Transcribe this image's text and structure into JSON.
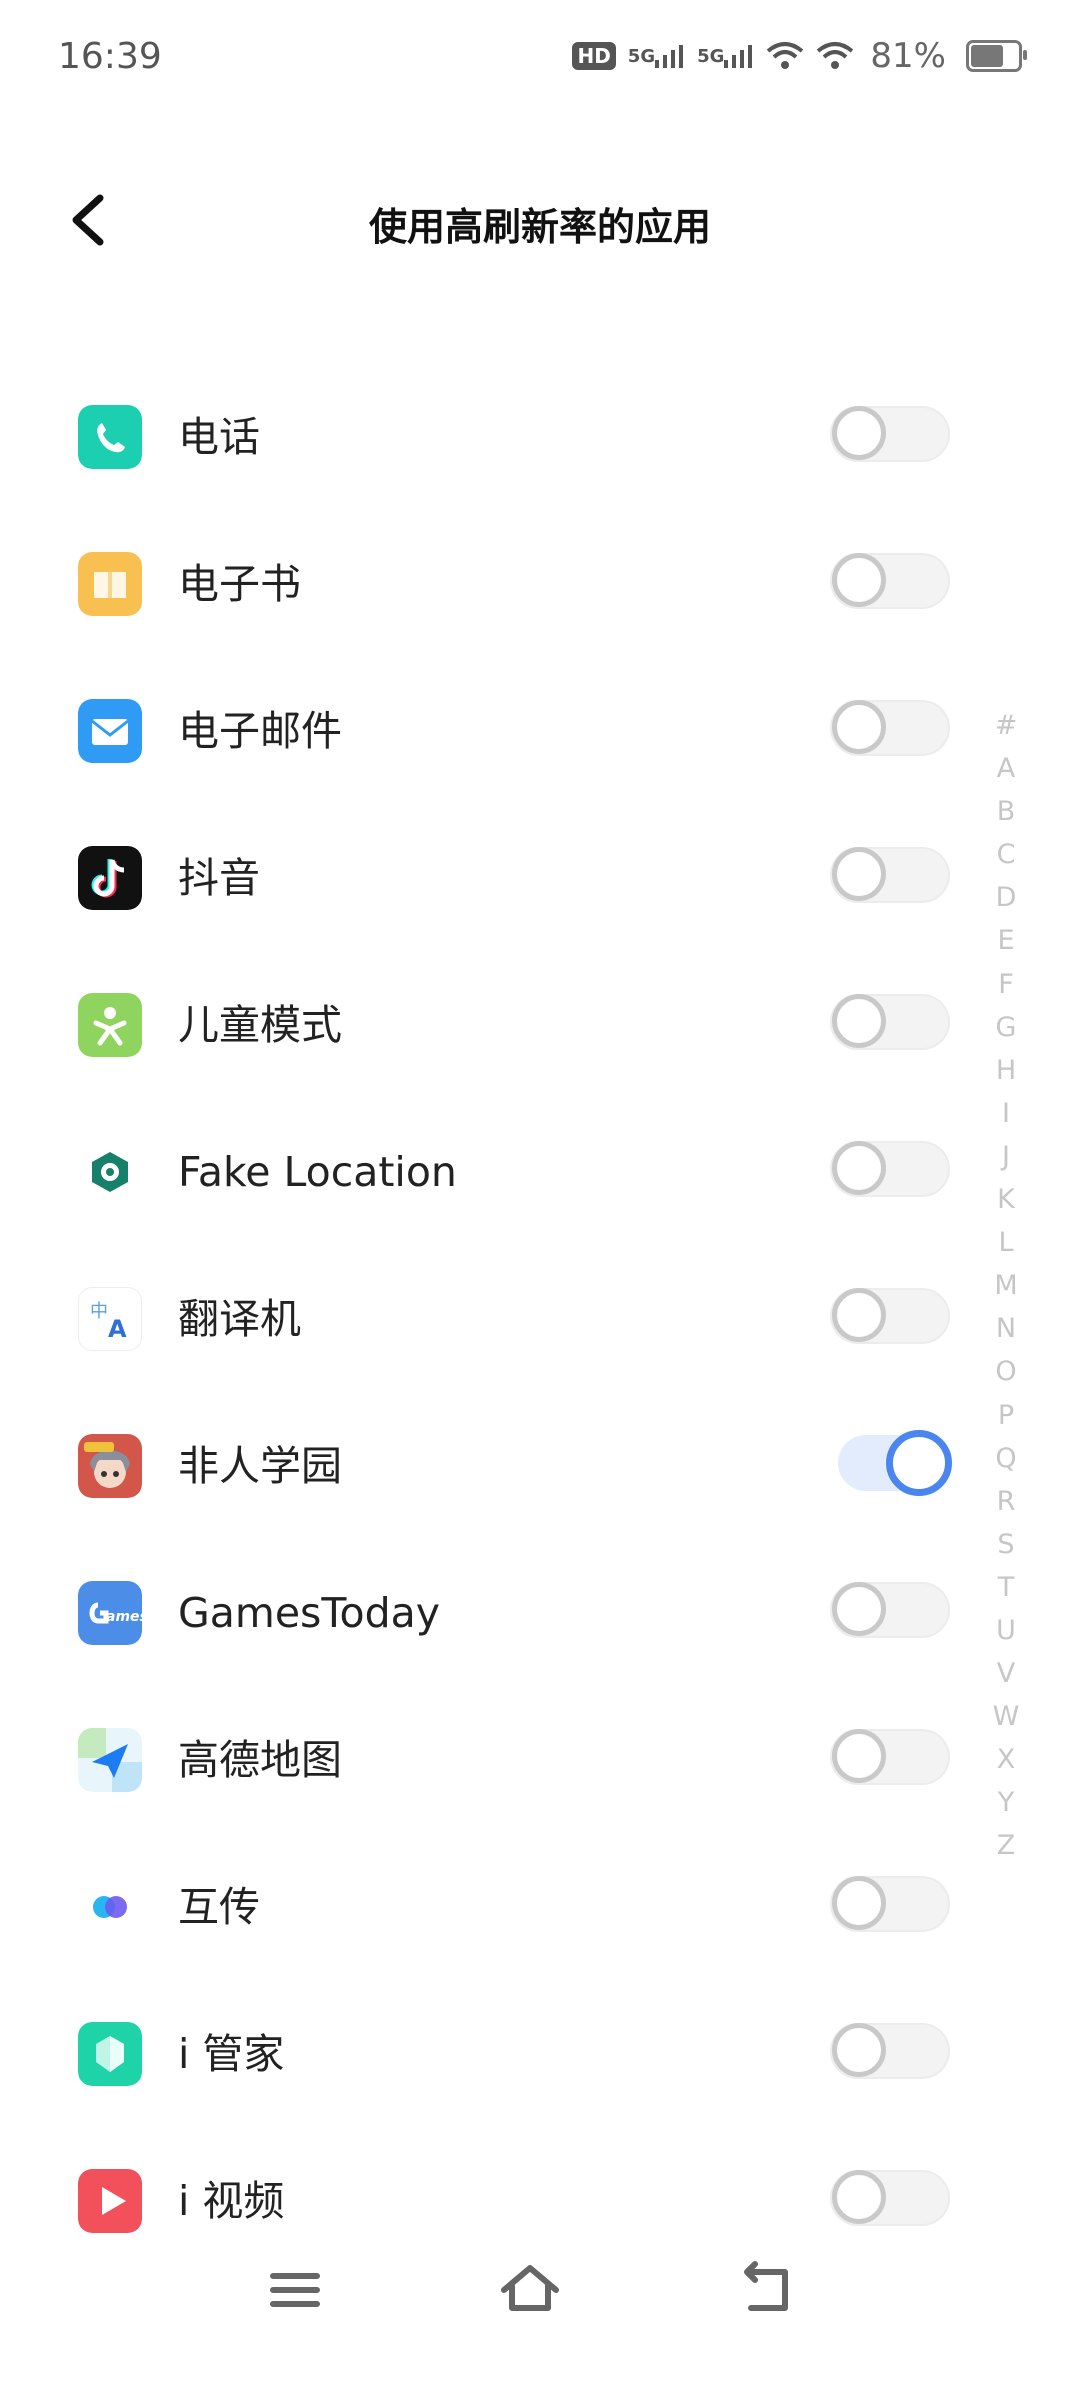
{
  "status_bar": {
    "time": "16:39",
    "hd_badge": "HD",
    "sim1_label": "5G",
    "sim2_label": "5G",
    "battery_percent": "81%",
    "battery_level": 0.81
  },
  "header": {
    "back_icon": "chevron-left-icon",
    "title": "使用高刷新率的应用"
  },
  "apps": [
    {
      "name": "电话",
      "icon": "phone-icon",
      "enabled": false
    },
    {
      "name": "电子书",
      "icon": "ebook-icon",
      "enabled": false
    },
    {
      "name": "电子邮件",
      "icon": "email-icon",
      "enabled": false
    },
    {
      "name": "抖音",
      "icon": "douyin-icon",
      "enabled": false
    },
    {
      "name": "儿童模式",
      "icon": "kids-mode-icon",
      "enabled": false
    },
    {
      "name": "Fake Location",
      "icon": "fake-location-icon",
      "enabled": false
    },
    {
      "name": "翻译机",
      "icon": "translator-icon",
      "enabled": false
    },
    {
      "name": "非人学园",
      "icon": "game-avatar-icon",
      "enabled": true
    },
    {
      "name": "GamesToday",
      "icon": "gamestoday-icon",
      "enabled": false
    },
    {
      "name": "高德地图",
      "icon": "amap-icon",
      "enabled": false
    },
    {
      "name": "互传",
      "icon": "share-icon",
      "enabled": false
    },
    {
      "name": "i 管家",
      "icon": "i-manager-icon",
      "enabled": false
    },
    {
      "name": "i 视频",
      "icon": "i-video-icon",
      "enabled": false
    }
  ],
  "alphabet_index": [
    "#",
    "A",
    "B",
    "C",
    "D",
    "E",
    "F",
    "G",
    "H",
    "I",
    "J",
    "K",
    "L",
    "M",
    "N",
    "O",
    "P",
    "Q",
    "R",
    "S",
    "T",
    "U",
    "V",
    "W",
    "X",
    "Y",
    "Z"
  ],
  "nav_bar": {
    "menu_icon": "menu-icon",
    "home_icon": "home-icon",
    "back_icon": "back-icon"
  },
  "colors": {
    "accent": "#4a86ee",
    "toggle_off_border": "#c9c9c9",
    "index_letter": "#c6c6c6"
  }
}
